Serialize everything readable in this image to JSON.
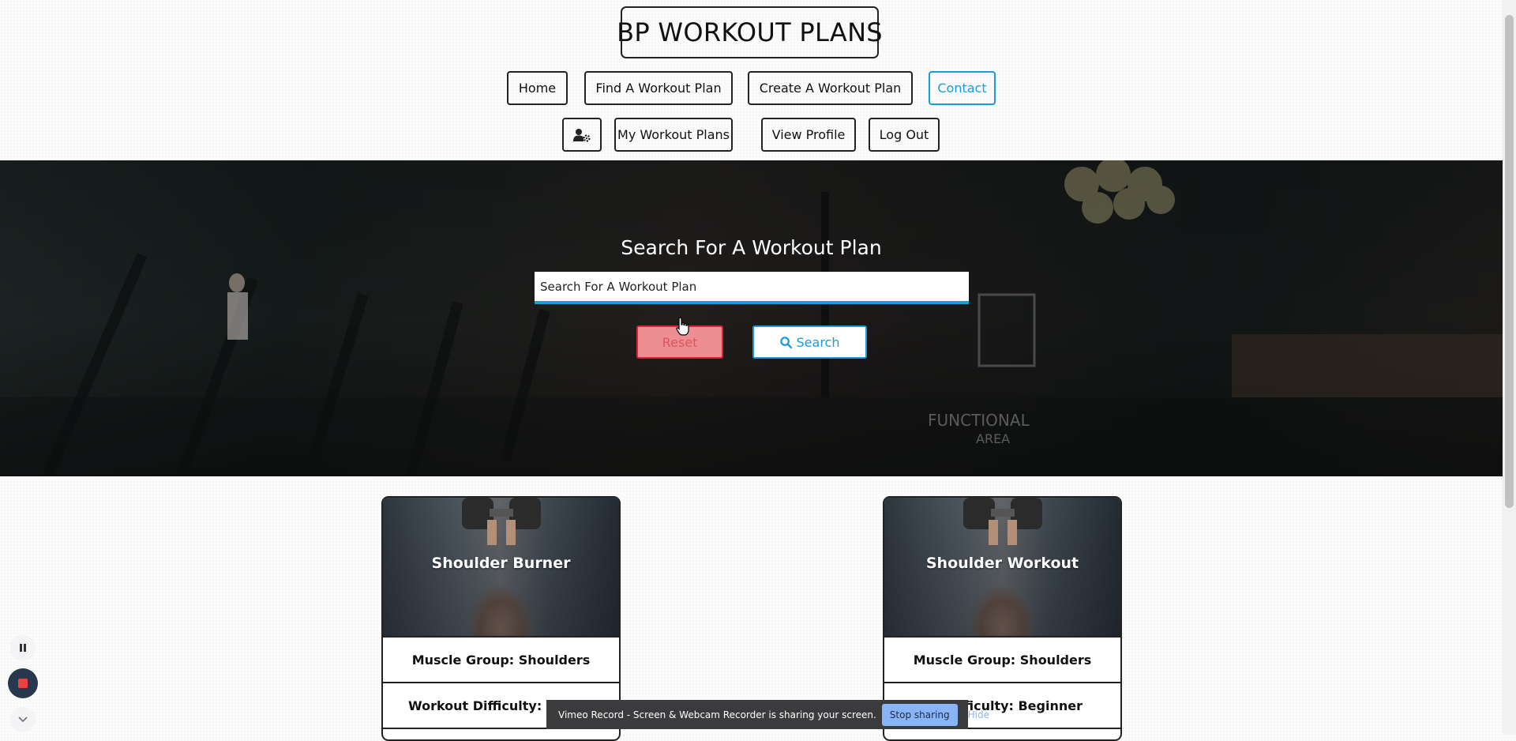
{
  "header": {
    "brand": "BP WORKOUT PLANS",
    "nav_row1": [
      "Home",
      "Find A Workout Plan",
      "Create A Workout Plan",
      "Contact"
    ],
    "nav_row2": [
      "My Workout Plans",
      "View Profile",
      "Log Out"
    ],
    "admin_icon": "user-gear-icon"
  },
  "hero": {
    "title": "Search For A Workout Plan",
    "search_placeholder": "Search For A Workout Plan",
    "reset_label": "Reset",
    "search_label": "Search"
  },
  "cards": [
    {
      "title": "Shoulder Burner",
      "muscle_group": "Muscle Group: Shoulders",
      "difficulty": "Workout Difficulty: Ad"
    },
    {
      "title": "Shoulder Workout",
      "muscle_group": "Muscle Group: Shoulders",
      "difficulty": "Difficulty: Beginner"
    }
  ],
  "recorder": {
    "message": "Vimeo Record - Screen & Webcam Recorder is sharing your screen.",
    "stop_label": "Stop sharing",
    "hide_label": "Hide",
    "controls": [
      "pause-icon",
      "stop-record-icon",
      "chevron-down-icon"
    ]
  },
  "colors": {
    "accent": "#1b9bd8",
    "danger": "#d8243a",
    "reset_fill": "#ec8e92",
    "share_button": "#8ab4f8"
  }
}
